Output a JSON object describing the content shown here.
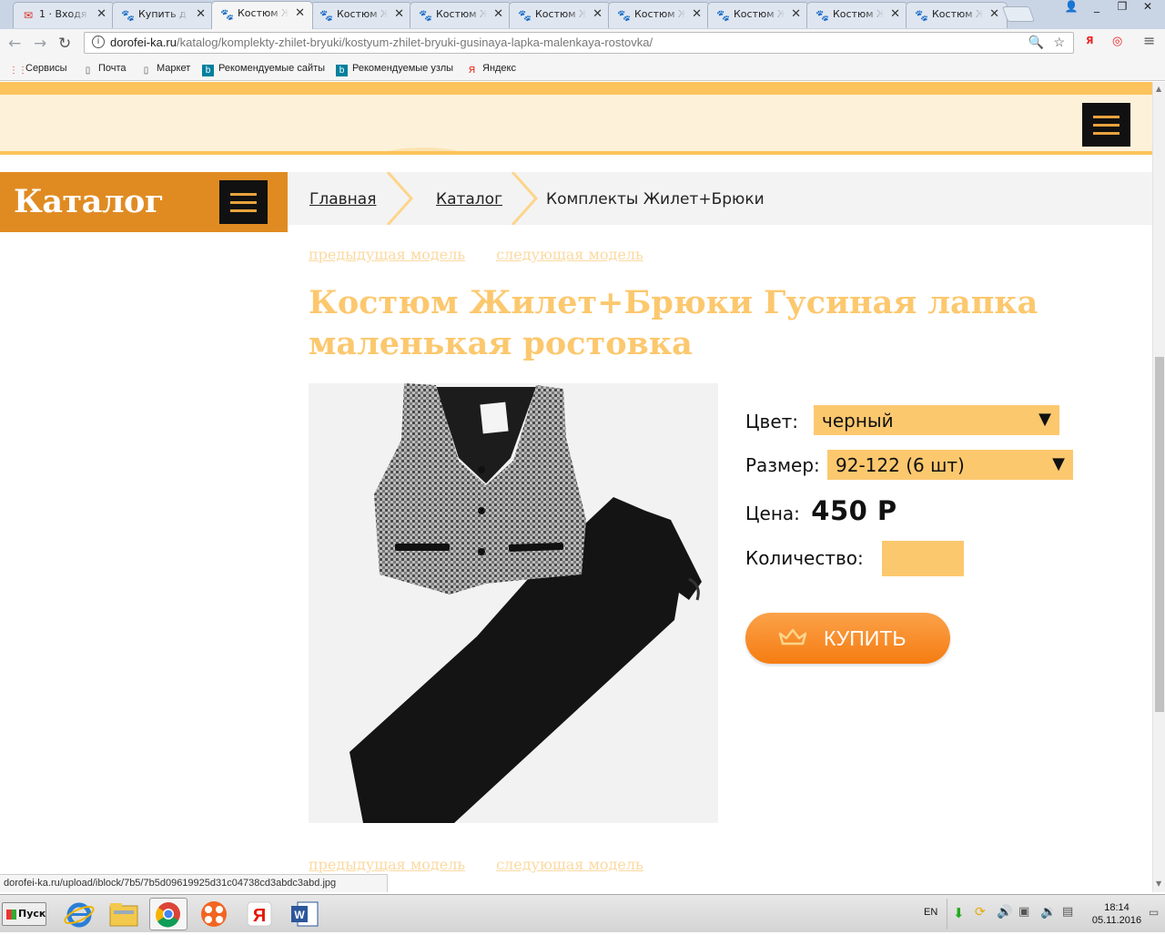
{
  "browser": {
    "tabs": [
      {
        "title": "1 · Входя",
        "icon": "gmail-icon",
        "glyph": "✉"
      },
      {
        "title": "Купить д",
        "icon": "paw-icon",
        "glyph": "🐾"
      },
      {
        "title": "Костюм Ж",
        "icon": "paw-icon",
        "glyph": "🐾",
        "active": true
      },
      {
        "title": "Костюм Ж",
        "icon": "paw-icon",
        "glyph": "🐾"
      },
      {
        "title": "Костюм Ж",
        "icon": "paw-icon",
        "glyph": "🐾"
      },
      {
        "title": "Костюм Ж",
        "icon": "paw-icon",
        "glyph": "🐾"
      },
      {
        "title": "Костюм Ж",
        "icon": "paw-icon",
        "glyph": "🐾"
      },
      {
        "title": "Костюм Ж",
        "icon": "paw-icon",
        "glyph": "🐾"
      },
      {
        "title": "Костюм Ж",
        "icon": "paw-icon",
        "glyph": "🐾"
      },
      {
        "title": "Костюм Ж",
        "icon": "paw-icon",
        "glyph": "🐾"
      }
    ],
    "url_host": "dorofei-ka.ru",
    "url_path": "/katalog/komplekty-zhilet-bryuki/kostyum-zhilet-bryuki-gusinaya-lapka-malenkaya-rostovka/",
    "bookmarks": [
      {
        "label": "Сервисы",
        "icon": "apps-grid-icon"
      },
      {
        "label": "Почта",
        "icon": "page-icon"
      },
      {
        "label": "Маркет",
        "icon": "page-icon"
      },
      {
        "label": "Рекомендуемые сайты",
        "icon": "bing-icon"
      },
      {
        "label": "Рекомендуемые узлы",
        "icon": "bing-icon"
      },
      {
        "label": "Яндекс",
        "icon": "yandex-icon"
      }
    ],
    "status_url": "dorofei-ka.ru/upload/iblock/7b5/7b5d09619925d31c04738cd3abdc3abd.jpg"
  },
  "site": {
    "catalog_title": "Каталог",
    "breadcrumbs": [
      {
        "label": "Главная",
        "link": true
      },
      {
        "label": "Каталог",
        "link": true
      },
      {
        "label": "Комплекты Жилет+Брюки",
        "link": false
      }
    ],
    "prev_model": "предыдущая модель",
    "next_model": "следующая модель",
    "product_title": "Костюм Жилет+Брюки Гусиная лапка маленькая ростовка",
    "options": {
      "color_label": "Цвет:",
      "color_value": "черный",
      "size_label": "Размер:",
      "size_value": "92-122 (6 шт)",
      "price_label": "Цена:",
      "price_value": "450 Р",
      "quantity_label": "Количество:",
      "quantity_value": ""
    },
    "buy_label": "КУПИТЬ",
    "colors": {
      "accent_orange": "#e08b22",
      "title_yellow": "#fcc86e",
      "field_yellow": "#fcc86e",
      "header_bg": "#fdf1d9"
    }
  },
  "taskbar": {
    "start_label": "Пуск",
    "apps": [
      "ie-icon",
      "file-manager-icon",
      "chrome-icon",
      "media-player-icon",
      "yandex-browser-icon",
      "word-icon"
    ],
    "lang": "EN",
    "time": "18:14",
    "date": "05.11.2016"
  }
}
